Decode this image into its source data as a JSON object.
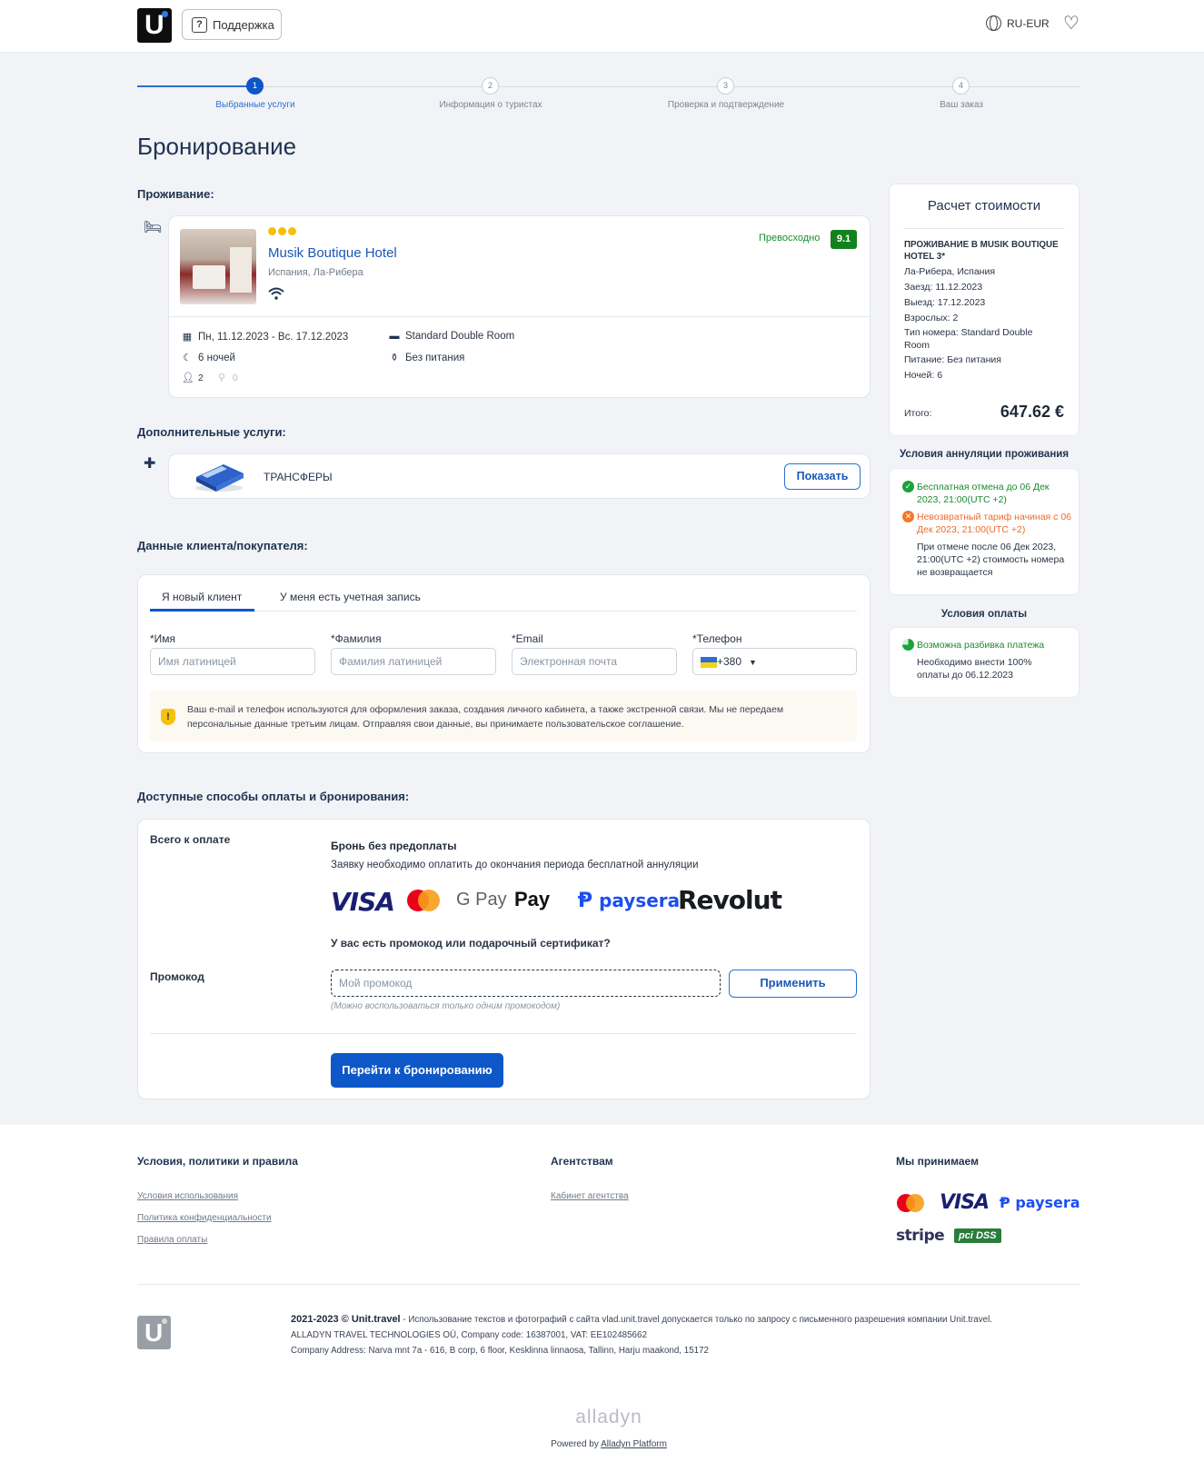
{
  "header": {
    "support_label": "Поддержка",
    "lang_label": "RU-EUR"
  },
  "steps": [
    {
      "num": "1",
      "label": "Выбранные услуги"
    },
    {
      "num": "2",
      "label": "Информация о туристах"
    },
    {
      "num": "3",
      "label": "Проверка и подтверждение"
    },
    {
      "num": "4",
      "label": "Ваш заказ"
    }
  ],
  "page_title": "Бронирование",
  "accommodation": {
    "section_title": "Проживание:",
    "hotel_name": "Musik Boutique Hotel",
    "location": "Испания, Ла-Рибера",
    "stars": 3,
    "rating_text": "Превосходно",
    "rating_value": "9.1",
    "dates": "Пн, 11.12.2023 - Вс. 17.12.2023",
    "nights": "6 ночей",
    "adults": "2",
    "children": "0",
    "room": "Standard Double Room",
    "meal": "Без питания"
  },
  "extras": {
    "section_title": "Дополнительные услуги:",
    "item_label": "ТРАНСФЕРЫ",
    "show_button": "Показать"
  },
  "client": {
    "section_title": "Данные клиента/покупателя:",
    "tabs": [
      "Я новый клиент",
      "У меня есть учетная запись"
    ],
    "fields": {
      "first_name_label": "*Имя",
      "first_name_placeholder": "Имя латиницей",
      "last_name_label": "*Фамилия",
      "last_name_placeholder": "Фамилия латиницей",
      "email_label": "*Email",
      "email_placeholder": "Электронная почта",
      "phone_label": "*Телефон",
      "phone_code": "+380"
    },
    "notice": "Ваш e-mail и телефон используются для оформления заказа, создания личного кабинета, а также экстренной связи. Мы не передаем персональные данные третьим лицам. Отправляя свои данные, вы принимаете пользовательское соглашение."
  },
  "payment": {
    "section_title": "Доступные способы оплаты и бронирования:",
    "total_label": "Всего к оплате",
    "option_title": "Бронь без предоплаты",
    "option_desc": "Заявку необходимо оплатить до окончания периода бесплатной аннуляции",
    "logos": [
      "VISA",
      "Mastercard",
      "G Pay",
      "Pay",
      "paysera",
      "Revolut"
    ],
    "promo_question": "У вас есть промокод или подарочный сертификат?",
    "promo_label": "Промокод",
    "promo_placeholder": "Мой промокод",
    "promo_apply": "Применить",
    "promo_hint": "(Можно воспользоваться только одним промокодом)",
    "submit": "Перейти к бронированию"
  },
  "summary": {
    "title": "Расчет стоимости",
    "heading": "ПРОЖИВАНИЕ В MUSIK BOUTIQUE HOTEL 3*",
    "lines": [
      "Ла-Рибера, Испания",
      "Заезд: 11.12.2023",
      "Выезд: 17.12.2023",
      "Взрослых: 2",
      "Тип номера: Standard Double Room",
      "Питание: Без питания",
      "Ночей: 6"
    ],
    "total_label": "Итого:",
    "total_value": "647.62 €"
  },
  "cancellation": {
    "title": "Условия аннуляции проживания",
    "free": "Бесплатная отмена до 06 Дек 2023, 21:00(UTC +2)",
    "nonrefund": "Невозвратный тариф начиная с 06 Дек 2023, 21:00(UTC +2)",
    "note": "При отмене после 06 Дек 2023, 21:00(UTC +2) стоимость номера не возвращается"
  },
  "payment_terms": {
    "title": "Условия оплаты",
    "split": "Возможна разбивка платежа",
    "note": "Необходимо внести 100% оплаты до 06.12.2023"
  },
  "footer": {
    "col1_title": "Условия, политики и правила",
    "col1_links": [
      "Условия использования",
      "Политика конфиденциальности",
      "Правила оплаты"
    ],
    "col2_title": "Агентствам",
    "col2_links": [
      "Кабинет агентства"
    ],
    "col3_title": "Мы принимаем",
    "accept_logos": [
      "VISA",
      "paysera",
      "stripe",
      "pci DSS"
    ],
    "copyright_bold": "2021-2023 © Unit.travel",
    "copyright_rest": " - Использование текстов и фотографий с сайта vlad.unit.travel допускается только по запросу с письменного разрешения компании Unit.travel.",
    "company": "ALLADYN TRAVEL TECHNOLOGIES OÜ, Company code: 16387001, VAT: EE102485662",
    "address": "Company Address: Narva mnt 7a - 616, B corp, 6 floor, Kesklinna linnaosa, Tallinn, Harju maakond, 15172",
    "brand": "alladyn",
    "powered_prefix": "Powered by ",
    "powered_link": "Alladyn Platform"
  }
}
